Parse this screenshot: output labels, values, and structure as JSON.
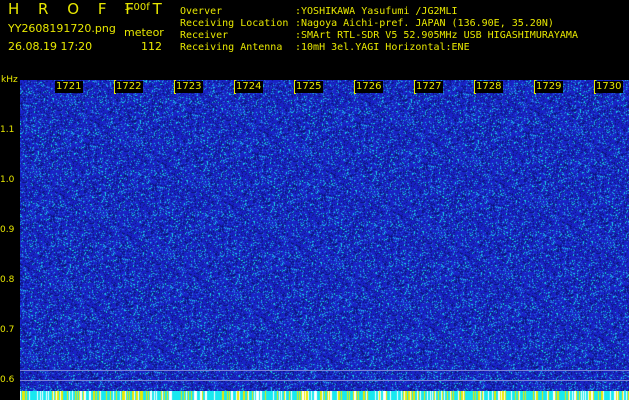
{
  "header": {
    "app_title": "H R O F F T",
    "version": "1.00f",
    "filename": "YY2608191720.png",
    "meteor_label": "meteor",
    "timestamp": "26.08.19 17:20",
    "meteor_count": "112"
  },
  "station_info": [
    {
      "key": "Overver",
      "value": ":YOSHIKAWA Yasufumi /JG2MLI"
    },
    {
      "key": "Receiving Location",
      "value": ":Nagoya Aichi-pref. JAPAN (136.90E, 35.20N)"
    },
    {
      "key": "Receiver",
      "value": ":SMArt RTL-SDR V5 52.905MHz USB HIGASHIMURAYAMA"
    },
    {
      "key": "Receiving Antenna",
      "value": ":10mH 3el.YAGI Horizontal:ENE"
    }
  ],
  "axis": {
    "unit": "kHz",
    "y_ticks": [
      "1.1",
      "1.0",
      "0.9",
      "0.8",
      "0.7",
      "0.6"
    ],
    "x_ticks": [
      "1721",
      "1722",
      "1723",
      "1724",
      "1725",
      "1726",
      "1727",
      "1728",
      "1729",
      "1730"
    ]
  },
  "colors": {
    "label": "#e8e800",
    "waterfall_bg": "#1a23b8",
    "noise_bright": "#18e0e8",
    "noise_dim": "#0a1a88"
  }
}
